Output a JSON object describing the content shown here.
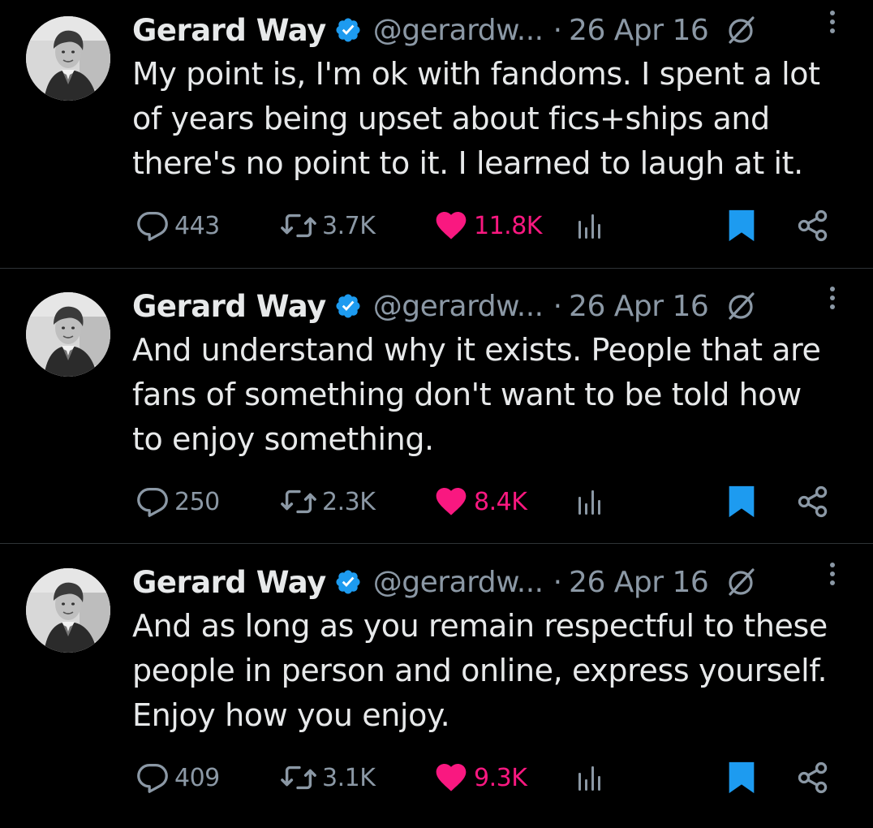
{
  "colors": {
    "background": "#000000",
    "text": "#e7e9ea",
    "muted": "#8b98a5",
    "verified": "#1d9bf0",
    "like": "#f91880",
    "bookmark": "#1d9bf0",
    "divider": "#2f3336"
  },
  "icons": {
    "verified": "verified-badge-icon",
    "grok": "grok-icon",
    "more": "more-options-icon",
    "reply": "reply-icon",
    "retweet": "retweet-icon",
    "like": "heart-icon",
    "views": "views-icon",
    "bookmark": "bookmark-icon",
    "share": "share-icon"
  },
  "tweets": [
    {
      "author": "Gerard Way",
      "handle": "@gerardw...",
      "separator": "·",
      "date": "26 Apr 16",
      "text": "My point is, I'm ok with fandoms. I spent a lot\nof years being upset about fics+ships and\nthere's no point to it. I learned to laugh at it.",
      "replies": "443",
      "retweets": "3.7K",
      "likes": "11.8K",
      "liked": true,
      "bookmarked": true
    },
    {
      "author": "Gerard Way",
      "handle": "@gerardw...",
      "separator": "·",
      "date": "26 Apr 16",
      "text": "And understand why it exists. People that are\nfans of something don't want to be told how\nto enjoy something.",
      "replies": "250",
      "retweets": "2.3K",
      "likes": "8.4K",
      "liked": true,
      "bookmarked": true
    },
    {
      "author": "Gerard Way",
      "handle": "@gerardw...",
      "separator": "·",
      "date": "26 Apr 16",
      "text": "And as long as you remain respectful to these\npeople in person and online, express yourself.\nEnjoy how you enjoy.",
      "replies": "409",
      "retweets": "3.1K",
      "likes": "9.3K",
      "liked": true,
      "bookmarked": true
    }
  ]
}
